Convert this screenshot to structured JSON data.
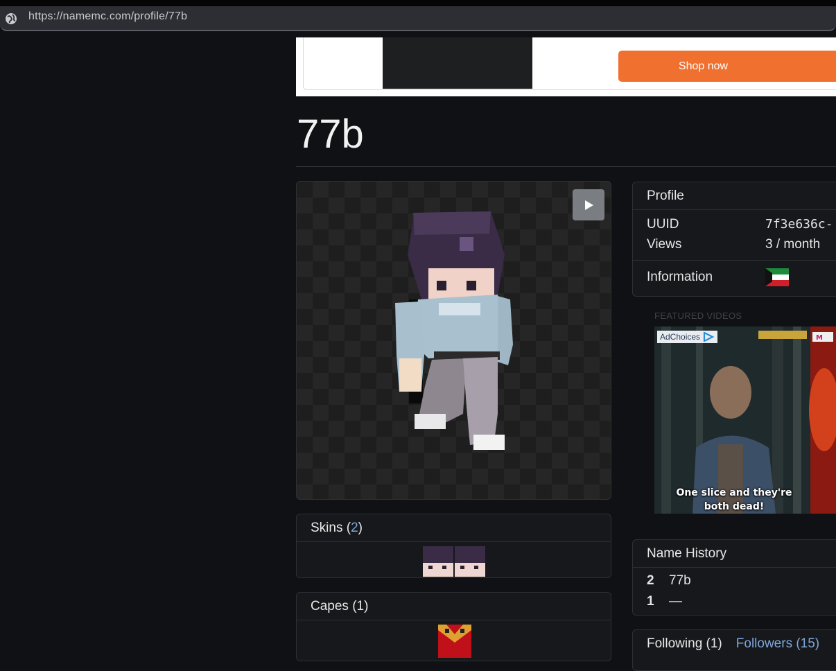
{
  "browser": {
    "url": "https://namemc.com/profile/77b"
  },
  "ad_banner": {
    "button_label": "Shop now",
    "colors": {
      "button": "#f07030"
    }
  },
  "profile": {
    "username": "77b"
  },
  "skin_viewer": {
    "play_icon": "play-icon"
  },
  "skins": {
    "label": "Skins",
    "count_open": "(",
    "count": "2",
    "count_close": ")"
  },
  "capes": {
    "label": "Capes (1)"
  },
  "profile_card": {
    "header": "Profile",
    "uuid_label": "UUID",
    "uuid_value": "7f3e636c-",
    "views_label": "Views",
    "views_value": "3 / month",
    "information_label": "Information",
    "flag_icon": "kuwait-flag-icon"
  },
  "featured": {
    "label": "FEATURED VIDEOS",
    "adchoices": "AdChoices",
    "caption": "One slice and they're both dead!"
  },
  "name_history": {
    "header": "Name History",
    "rows": [
      {
        "index": "2",
        "name": "77b"
      },
      {
        "index": "1",
        "name": "—"
      }
    ]
  },
  "social": {
    "following": "Following (1)",
    "followers": "Followers (15)"
  }
}
